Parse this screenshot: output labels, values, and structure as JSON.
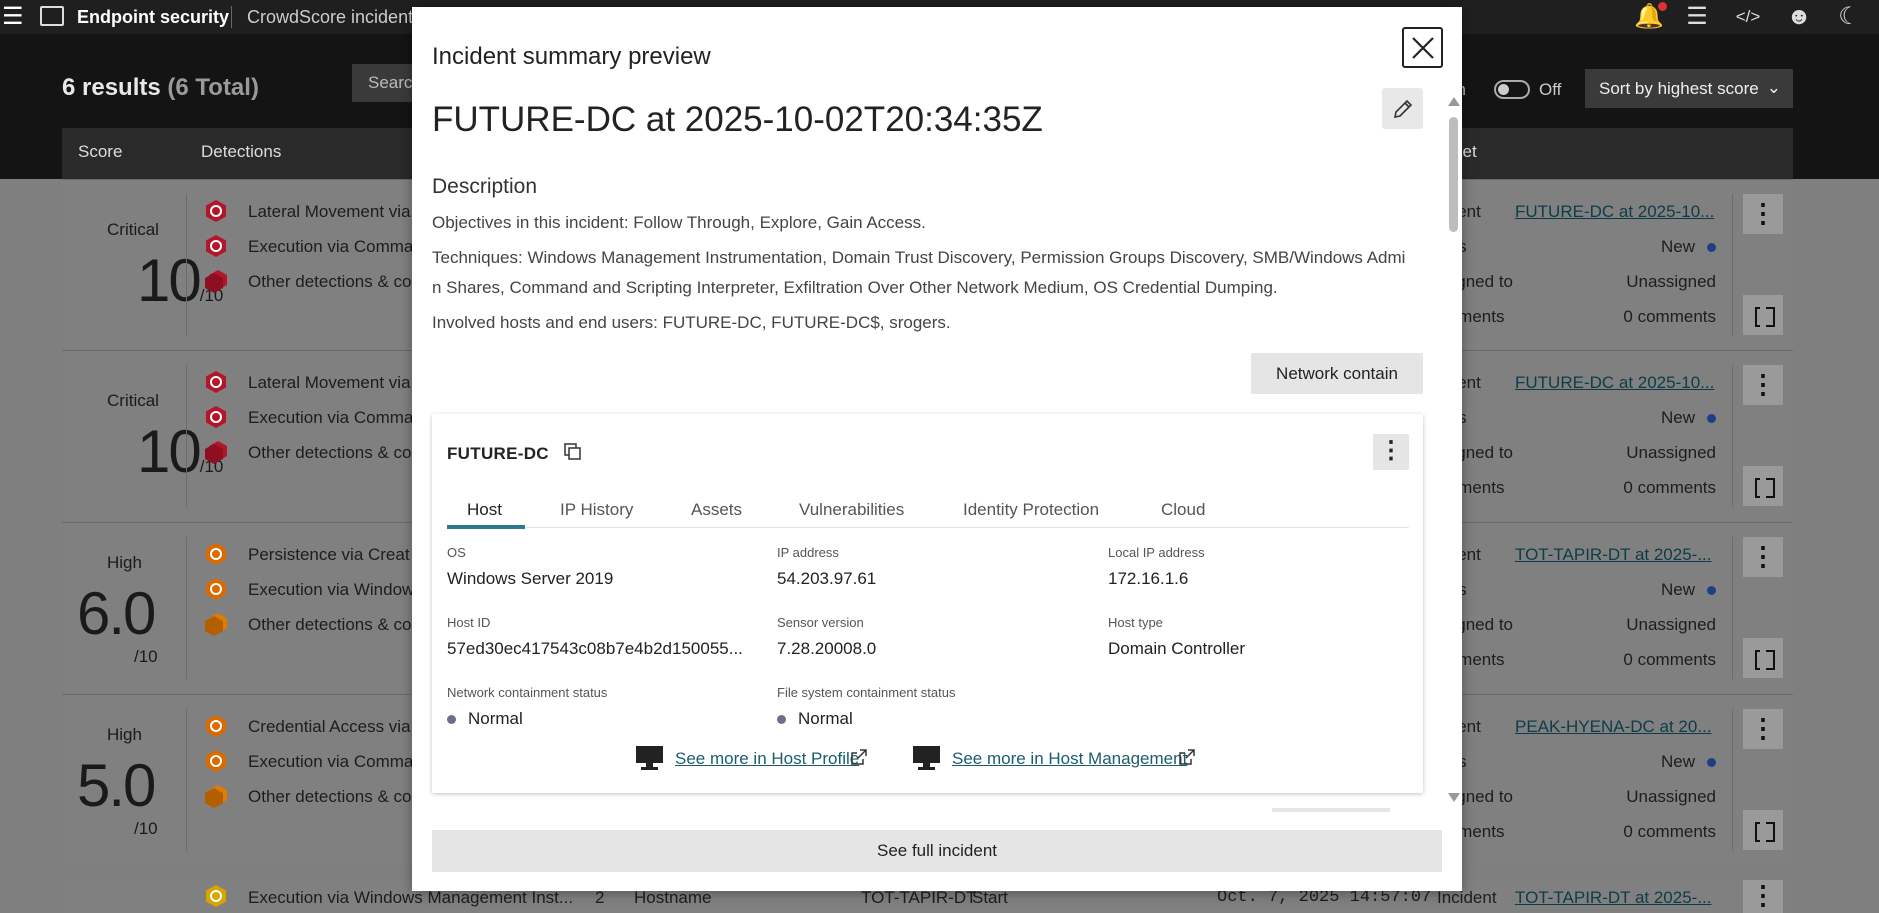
{
  "topbar": {
    "app_name": "Endpoint security",
    "breadcrumb": "CrowdScore incidents",
    "icons": [
      "menu-icon",
      "app-icon",
      "notifications-icon",
      "messages-icon",
      "code-icon",
      "user-icon",
      "dark-mode-icon"
    ]
  },
  "toolbar": {
    "results_count": "6 results",
    "results_total": "(6 Total)",
    "search_placeholder": "Search",
    "refresh_label": "sh",
    "toggle_state": "Off",
    "sort_label": "Sort by highest score"
  },
  "table": {
    "headers": [
      "Score",
      "Detections",
      "ket"
    ],
    "rows": [
      {
        "severity": "Critical",
        "score": "10",
        "denom": "/10",
        "detections": [
          "Lateral Movement via",
          "Execution via Comma",
          "Other detections & co"
        ],
        "incident_label": "ident",
        "incident_link": "FUTURE-DC at 2025-10...",
        "status_label": "tus",
        "status": "New",
        "assigned_label": "signed to",
        "assigned": "Unassigned",
        "comments_label": "mments",
        "comments": "0 comments"
      },
      {
        "severity": "Critical",
        "score": "10",
        "denom": "/10",
        "detections": [
          "Lateral Movement via",
          "Execution via Comma",
          "Other detections & co"
        ],
        "incident_label": "ident",
        "incident_link": "FUTURE-DC at 2025-10...",
        "status_label": "tus",
        "status": "New",
        "assigned_label": "signed to",
        "assigned": "Unassigned",
        "comments_label": "mments",
        "comments": "0 comments"
      },
      {
        "severity": "High",
        "score": "6.0",
        "denom": "/10",
        "detections": [
          "Persistence via Creat",
          "Execution via Window",
          "Other detections & co"
        ],
        "incident_label": "ident",
        "incident_link": "TOT-TAPIR-DT at 2025-...",
        "status_label": "tus",
        "status": "New",
        "assigned_label": "signed to",
        "assigned": "Unassigned",
        "comments_label": "mments",
        "comments": "0 comments"
      },
      {
        "severity": "High",
        "score": "5.0",
        "denom": "/10",
        "detections": [
          "Credential Access via",
          "Execution via Comma",
          "Other detections & co"
        ],
        "incident_label": "ident",
        "incident_link": "PEAK-HYENA-DC at 20...",
        "status_label": "tus",
        "status": "New",
        "assigned_label": "signed to",
        "assigned": "Unassigned",
        "comments_label": "mments",
        "comments": "0 comments"
      }
    ],
    "partial_row": {
      "detection": "Execution via Windows Management Inst...",
      "count": "2",
      "hostname_label": "Hostname",
      "hostname": "TOT-TAPIR-DT",
      "start_label": "Start",
      "start": "Oct. 7, 2025 14:57:07",
      "incident_label": "Incident",
      "incident_link": "TOT-TAPIR-DT at 2025-..."
    }
  },
  "colors": {
    "critical": "#c8102e",
    "high": "#e07b00",
    "medium": "#d9a400",
    "link": "#1a5e6e",
    "tab_accent": "#2a7a8c"
  },
  "modal": {
    "title": "Incident summary preview",
    "incident_name": "FUTURE-DC at 2025-10-02T20:34:35Z",
    "description_heading": "Description",
    "objectives": "Objectives in this incident: Follow Through, Explore, Gain Access.",
    "techniques_line1": "Techniques: Windows Management Instrumentation, Domain Trust Discovery, Permission Groups Discovery, SMB/Windows Admi",
    "techniques_line2": "n Shares, Command and Scripting Interpreter, Exfiltration Over Other Network Medium, OS Credential Dumping.",
    "involved": "Involved hosts and end users: FUTURE-DC, FUTURE-DC$, srogers.",
    "network_contain_label": "Network contain",
    "host": {
      "name": "FUTURE-DC",
      "tabs": [
        "Host",
        "IP History",
        "Assets",
        "Vulnerabilities",
        "Identity Protection",
        "Cloud"
      ],
      "fields": {
        "os_label": "OS",
        "os": "Windows Server 2019",
        "ip_label": "IP address",
        "ip": "54.203.97.61",
        "local_ip_label": "Local IP address",
        "local_ip": "172.16.1.6",
        "host_id_label": "Host ID",
        "host_id": "57ed30ec417543c08b7e4b2d150055...",
        "sensor_label": "Sensor version",
        "sensor": "7.28.20008.0",
        "host_type_label": "Host type",
        "host_type": "Domain Controller",
        "net_contain_label": "Network containment status",
        "net_contain": "Normal",
        "fs_contain_label": "File system containment status",
        "fs_contain": "Normal"
      },
      "link_profile": "See more in Host Profile",
      "link_management": "See more in Host Management"
    },
    "full_incident_label": "See full incident"
  }
}
